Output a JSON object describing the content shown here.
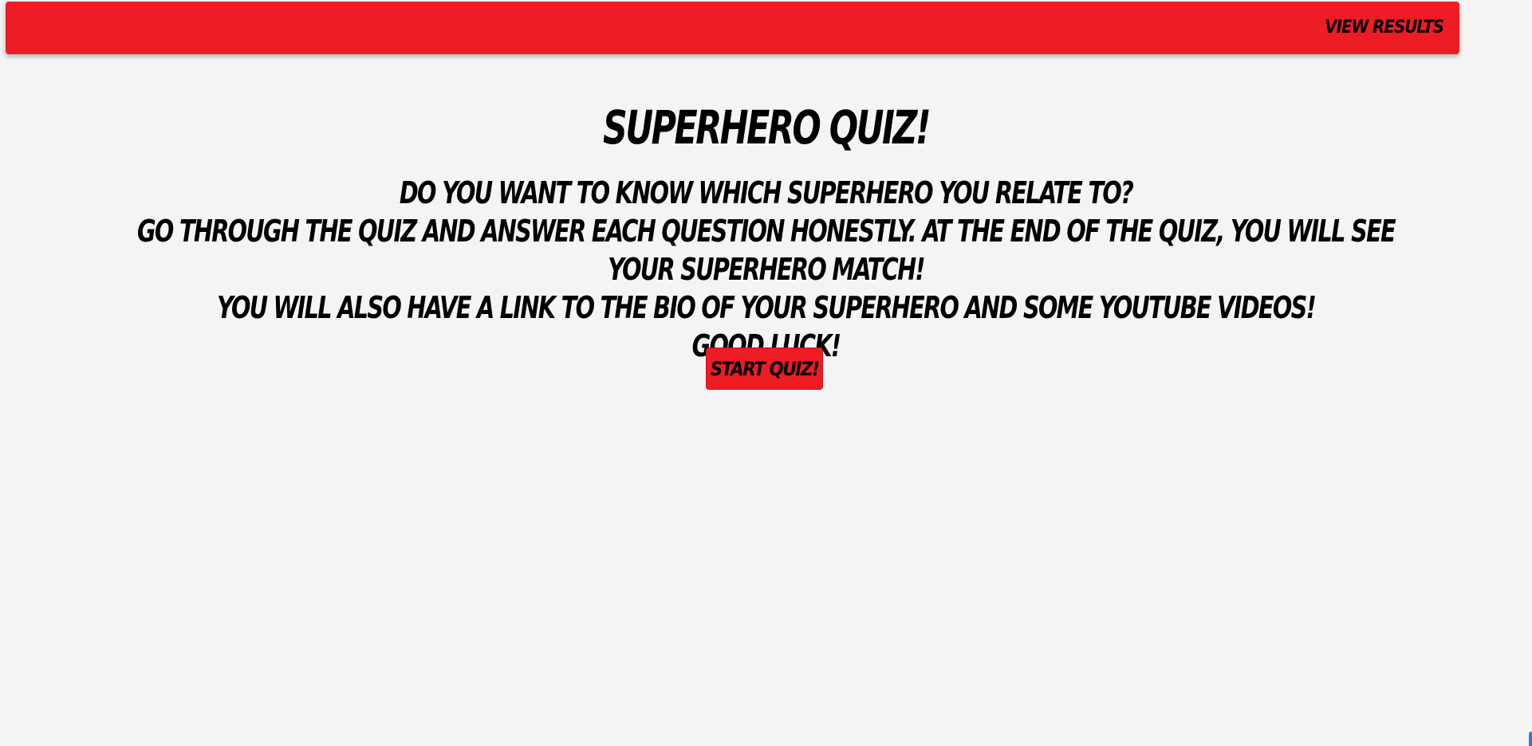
{
  "navbar": {
    "view_results_label": "View Results",
    "color": "#ee1c24"
  },
  "main": {
    "title": "Superhero Quiz!",
    "intro_lines": [
      "Do you want to know which superhero you relate to?",
      "Go through the quiz and answer each question honestly. At the end of the quiz, you will see your superhero match!",
      "You will also have a link to the bio of your superhero and some YouTube videos!",
      "Good luck!"
    ],
    "start_button_label": "Start Quiz!"
  },
  "colors": {
    "background": "#f4f4f4",
    "accent": "#ee1c24",
    "text": "#000000"
  }
}
